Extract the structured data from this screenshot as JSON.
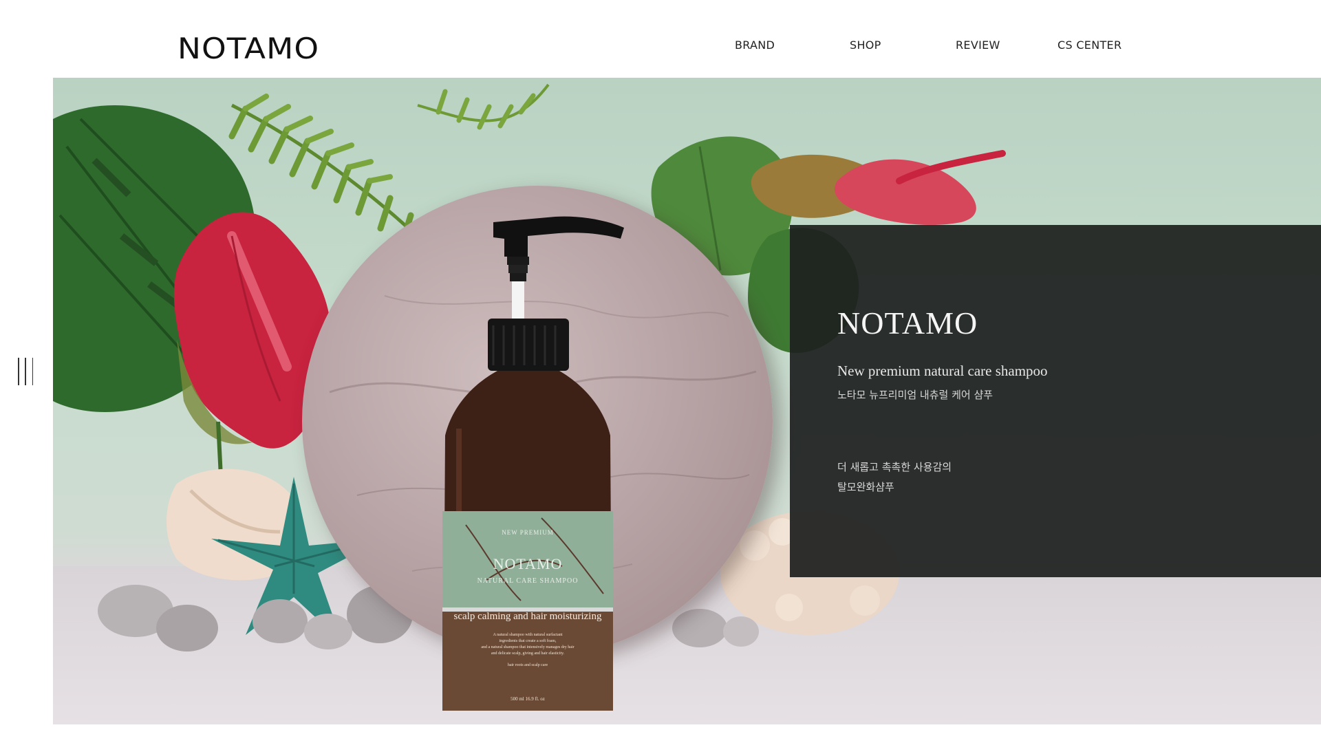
{
  "header": {
    "logo": "NOTAMO",
    "nav": [
      "BRAND",
      "SHOP",
      "REVIEW",
      "CS CENTER"
    ]
  },
  "hero": {
    "title": "NOTAMO",
    "subtitle": "New premium natural care shampoo",
    "korean_subtitle": "노타모 뉴프리미엄 내츄럴 케어 샴푸",
    "description_line1": "더 새롭고 촉촉한 사용감의",
    "description_line2": "탈모완화샴푸"
  },
  "product_label": {
    "tag": "NEW PREMIUM",
    "brand": "NOTAMO",
    "name": "NATURAL CARE SHAMPOO",
    "claim": "scalp calming and hair moisturizing",
    "body1": "A natural shampoo with natural surfactant",
    "body2": "ingredients that create a soft foam,",
    "body3": "and a natural shampoo that intensively manages dry hair",
    "body4": "and delicate scalp, giving and hair elasticity.",
    "body5": "hair roots and scalp care",
    "volume": "500 ml 16.9 fl. oz"
  },
  "icons": {
    "menu": "menu-bars-icon"
  },
  "colors": {
    "info_box": "#1e201f",
    "background_mint": "#c6dccd",
    "label_green": "#8faf98",
    "label_brown": "#6b4a35"
  }
}
